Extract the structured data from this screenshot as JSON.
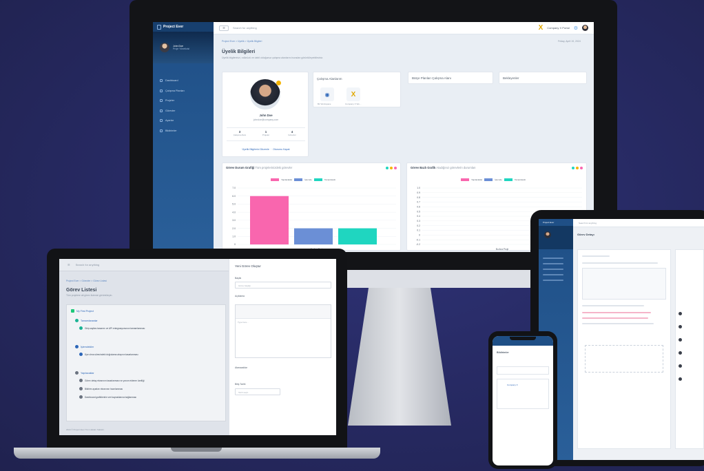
{
  "monitor": {
    "sidebar": {
      "brand": "Project Ever",
      "user_name": "John Doe",
      "user_role": "Proje Yöneticisi",
      "menu": [
        "Dashboard",
        "Çalışma Planları",
        "Projeler",
        "Görevler",
        "Ayarlar",
        "Bildirimler"
      ]
    },
    "topbar": {
      "menu_btn": "☰",
      "search": "Search for anything",
      "company": "Company X Portal",
      "company_icon": "x-logo-icon",
      "settings_icon": "gear-icon"
    },
    "breadcrumb": "Project Ever  >  Üyelik  >  Üyelik Bilgileri",
    "date": "Friday, April 19, 2024",
    "page_title": "Üyelik Bilgileri",
    "page_subtitle": "Üyelik bilgilerinizi, rolünüzü ve dahil olduğunuz çalışma alanlarını buradan görüntüleyebilirsiniz.",
    "profile": {
      "name": "John Doe",
      "email": "johndoe@company.com",
      "stats": [
        {
          "value": "3",
          "label": "Çalışma Alanı"
        },
        {
          "value": "1",
          "label": "Projeler"
        },
        {
          "value": "4",
          "label": "Görevler"
        }
      ],
      "edit_link": "Üyelik Bilgilerini Düzenle",
      "logout_link": "Oturumu Kapat"
    },
    "workspaces": {
      "title": "Çalışma Alanlarım",
      "items": [
        {
          "label": "Bir Workspace",
          "icon": "workspace-icon"
        },
        {
          "label": "Company X Wo...",
          "icon": "x-logo-icon"
        }
      ]
    },
    "other_cards": [
      "Bütçe Planları Çalışma Alanı",
      "Bekleyenler"
    ],
    "chart1": {
      "title": "Görev Durum Grafiği",
      "subtitle": "Tüm projelerinizdeki görevler"
    },
    "chart2": {
      "title": "Görev Bazlı Grafik",
      "subtitle": "Atadığınız görevlerin durumları"
    }
  },
  "chart_data": [
    {
      "type": "bar",
      "categories": [
        "Bu Ana Proje"
      ],
      "series": [
        {
          "name": "Yapılacaklar",
          "values": [
            6
          ],
          "color": "#f966ae"
        },
        {
          "name": "İşlemde",
          "values": [
            2
          ],
          "color": "#6b8fd6"
        },
        {
          "name": "Tamamlandı",
          "values": [
            2
          ],
          "color": "#1fd6c0"
        }
      ],
      "ylim": [
        0,
        7
      ],
      "yticks": [
        "7.0",
        "6.0",
        "5.0",
        "4.0",
        "3.0",
        "2.0",
        "1.0",
        "0"
      ],
      "legend": "top-center"
    },
    {
      "type": "bar",
      "categories": [
        "Bu Ana Proje"
      ],
      "series": [
        {
          "name": "Yapılacaklar",
          "values": [
            0
          ],
          "color": "#f966ae"
        },
        {
          "name": "İşlemde",
          "values": [
            0
          ],
          "color": "#6b8fd6"
        },
        {
          "name": "Tamamlandı",
          "values": [
            0
          ],
          "color": "#1fd6c0"
        }
      ],
      "ylim": [
        -0.2,
        1
      ],
      "yticks": [
        "1.0",
        "0.9",
        "0.8",
        "0.7",
        "0.6",
        "0.5",
        "0.4",
        "0.3",
        "0.2",
        "0.1",
        "0",
        "-0.1",
        "-0.2"
      ],
      "legend": "top-center"
    }
  ],
  "laptop": {
    "search": "Search for anything",
    "breadcrumb": "Project Ever  >  Görevler  >  Görev Listesi",
    "title": "Görev Listesi",
    "subtitle": "Tüm projelere ait görev listenizi görüntüleyin.",
    "project": "My First Project",
    "sections": [
      {
        "name": "Tamamlananlar",
        "tasks": [
          "Giriş sayfası tasarımı ve API entegrasyonunun tamamlanması"
        ]
      },
      {
        "name": "İşlemdekiler",
        "tasks": [
          "Üye olma sürecindeki doğrulama akışının tasarlanması"
        ]
      },
      {
        "name": "Yapılacaklar",
        "tasks": [
          "Görev detay ekranının tasarlanması ve yorum ekleme özelliği",
          "Bildirim ayarları ekranının hazırlanması",
          "Dashboard grafiklerinin veri kaynaklarına bağlanması"
        ]
      }
    ],
    "panel": {
      "title": "Yeni Görev Oluştur",
      "label_title": "Başlık",
      "placeholder_title": "Görev başlığı",
      "label_desc": "Açıklama",
      "placeholder_desc": "Type here...",
      "label_assignee": "Atanacaklar",
      "label_date": "Bitiş Tarihi",
      "placeholder_date": "Tarih seçin"
    },
    "footer": "2024 © Project Ever Tüm Hakları Saklıdır."
  },
  "tablet": {
    "brand": "Project Ever",
    "search": "Search for anything",
    "title": "Görev Detayı"
  },
  "phone": {
    "title": "Bildirimler",
    "item": "Company X"
  }
}
